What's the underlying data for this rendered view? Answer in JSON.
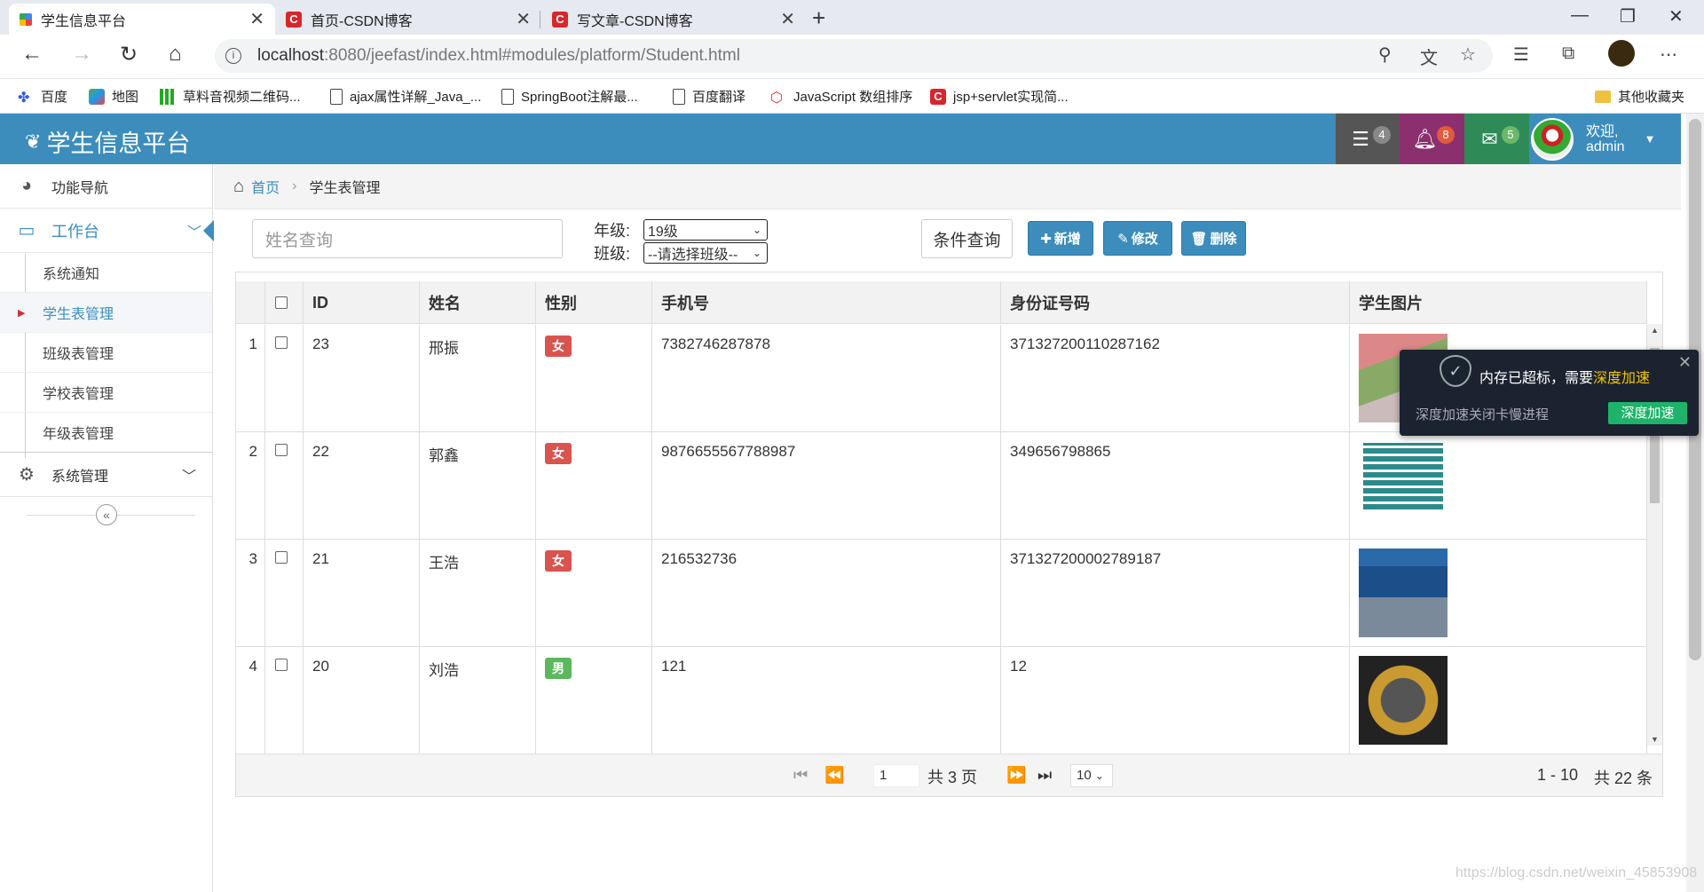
{
  "browser": {
    "tabs": [
      {
        "title": "学生信息平台",
        "active": true
      },
      {
        "title": "首页-CSDN博客",
        "active": false
      },
      {
        "title": "写文章-CSDN博客",
        "active": false
      }
    ],
    "url_host": "localhost",
    "url_rest": ":8080/jeefast/index.html#modules/platform/Student.html",
    "bookmarks": [
      "百度",
      "地图",
      "草料音视频二维码...",
      "ajax属性详解_Java_...",
      "SpringBoot注解最...",
      "百度翻译",
      "JavaScript 数组排序",
      "jsp+servlet实现简..."
    ],
    "other_bookmarks": "其他收藏夹"
  },
  "app": {
    "title": "学生信息平台",
    "badges": {
      "tasks": "4",
      "notifications": "8",
      "messages": "5"
    },
    "user_welcome": "欢迎,",
    "user_name": "admin",
    "colors": {
      "header": "#3c8dbc",
      "tasks": "#555555",
      "notifications": "#8b2f6e",
      "messages": "#2e8b57",
      "female": "#d9534f",
      "male": "#5cb85c"
    }
  },
  "sidebar": {
    "nav": "功能导航",
    "workbench": "工作台",
    "items": [
      "系统通知",
      "学生表管理",
      "班级表管理",
      "学校表管理",
      "年级表管理"
    ],
    "system": "系统管理"
  },
  "breadcrumb": {
    "home": "首页",
    "current": "学生表管理"
  },
  "toolbar": {
    "name_placeholder": "姓名查询",
    "grade_label": "年级:",
    "grade_value": "19级",
    "class_label": "班级:",
    "class_value": "--请选择班级--",
    "query": "条件查询",
    "add": "新增",
    "edit": "修改",
    "delete": "删除"
  },
  "table": {
    "headers": [
      "ID",
      "姓名",
      "性别",
      "手机号",
      "身份证号码",
      "学生图片"
    ],
    "rows": [
      {
        "n": "1",
        "id": "23",
        "name": "邢振",
        "sex": "女",
        "phone": "7382746287878",
        "idcard": "371327200110287162"
      },
      {
        "n": "2",
        "id": "22",
        "name": "郭鑫",
        "sex": "女",
        "phone": "9876655567788987",
        "idcard": "349656798865"
      },
      {
        "n": "3",
        "id": "21",
        "name": "王浩",
        "sex": "女",
        "phone": "216532736",
        "idcard": "371327200002789187"
      },
      {
        "n": "4",
        "id": "20",
        "name": "刘浩",
        "sex": "男",
        "phone": "121",
        "idcard": "12"
      }
    ]
  },
  "pager": {
    "page": "1",
    "total_pages": "共 3 页",
    "page_size": "10",
    "range": "1 - 10",
    "total": "共 22 条"
  },
  "popup": {
    "msg_prefix": "内存已超标，需要",
    "msg_highlight": "深度加速",
    "sub": "深度加速关闭卡慢进程",
    "button": "深度加速"
  },
  "watermark": "https://blog.csdn.net/weixin_45853908"
}
